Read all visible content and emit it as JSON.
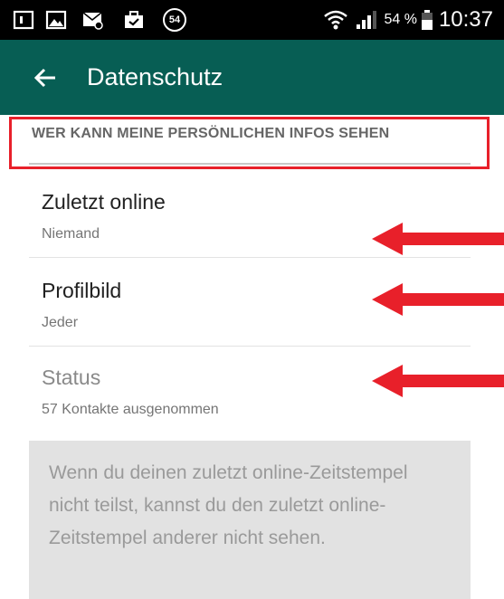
{
  "status_bar": {
    "notification_count": "54",
    "battery_percent": "54 %",
    "time": "10:37",
    "icons": [
      "notification-square-icon",
      "image-icon",
      "message-icon",
      "briefcase-check-icon",
      "wifi-icon",
      "signal-icon",
      "battery-icon"
    ]
  },
  "toolbar": {
    "back_icon": "arrow-left-icon",
    "title": "Datenschutz"
  },
  "section": {
    "header": "WER KANN MEINE PERSÖNLICHEN INFOS SEHEN"
  },
  "items": [
    {
      "title": "Zuletzt online",
      "subtitle": "Niemand",
      "enabled": true
    },
    {
      "title": "Profilbild",
      "subtitle": "Jeder",
      "enabled": true
    },
    {
      "title": "Status",
      "subtitle": "57 Kontakte ausgenommen",
      "enabled": false
    }
  ],
  "info": {
    "text": "Wenn du deinen zuletzt online-Zeitstempel nicht teilst, kannst du den zuletzt online-Zeitstempel anderer nicht sehen."
  },
  "colors": {
    "toolbar": "#075e54",
    "annotation_red": "#e8202a",
    "status_bar": "#000000"
  }
}
